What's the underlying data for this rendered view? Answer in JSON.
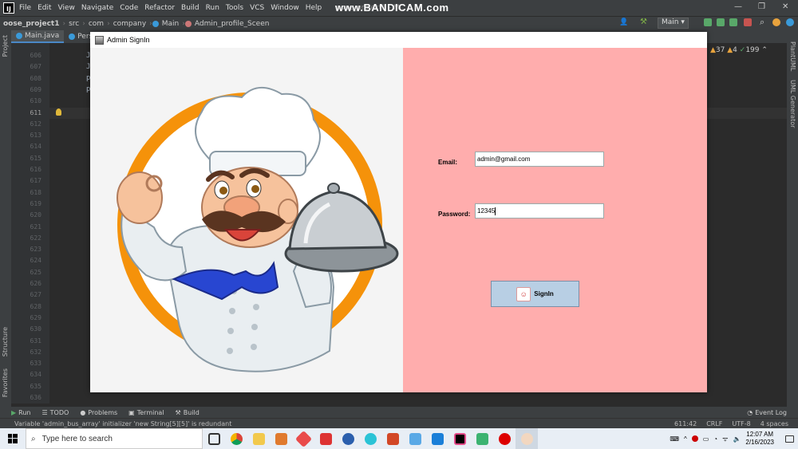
{
  "ide": {
    "menu": [
      "File",
      "Edit",
      "View",
      "Navigate",
      "Code",
      "Refactor",
      "Build",
      "Run",
      "Tools",
      "VCS",
      "Window",
      "Help"
    ],
    "window_title": "oose_project1 - M...",
    "watermark": "www.BANDICAM.com",
    "breadcrumbs": [
      "oose_project1",
      "src",
      "com",
      "company",
      "Main",
      "Admin_profile_Sceen"
    ],
    "run_config": "Main",
    "tabs": [
      "Main.java",
      "Pers..."
    ],
    "inspection": {
      "warnings": "37",
      "weak": "4",
      "typos": "199"
    },
    "line_numbers": [
      "606",
      "607",
      "608",
      "609",
      "610",
      "611",
      "612",
      "613",
      "614",
      "615",
      "616",
      "617",
      "618",
      "619",
      "620",
      "621",
      "622",
      "623",
      "624",
      "625",
      "626",
      "627",
      "628",
      "629",
      "630",
      "631",
      "632",
      "633",
      "634",
      "635",
      "636"
    ],
    "current_line": "611",
    "left_strip": [
      "Project",
      "Structure",
      "Favorites"
    ],
    "right_strip": [
      "PlantUML",
      "UML Generator"
    ],
    "tool_windows": [
      "Run",
      "TODO",
      "Problems",
      "Terminal",
      "Build"
    ],
    "event_log": "Event Log",
    "status_message": "Variable 'admin_bus_array' initializer 'new String[5][5]' is redundant",
    "status_right": [
      "611:42",
      "CRLF",
      "UTF-8",
      "4 spaces"
    ]
  },
  "dialog": {
    "title": "Admin SignIn",
    "email_label": "Email:",
    "email_value": "admin@gmail.com",
    "password_label": "Password:",
    "password_value": "12345",
    "signin_label": "SignIn",
    "colors": {
      "left_panel": "#f4f4f4",
      "right_panel": "#ffadad",
      "button": "#b8cfe4"
    }
  },
  "taskbar": {
    "search_placeholder": "Type here to search",
    "time": "12:07 AM",
    "date": "2/16/2023"
  }
}
